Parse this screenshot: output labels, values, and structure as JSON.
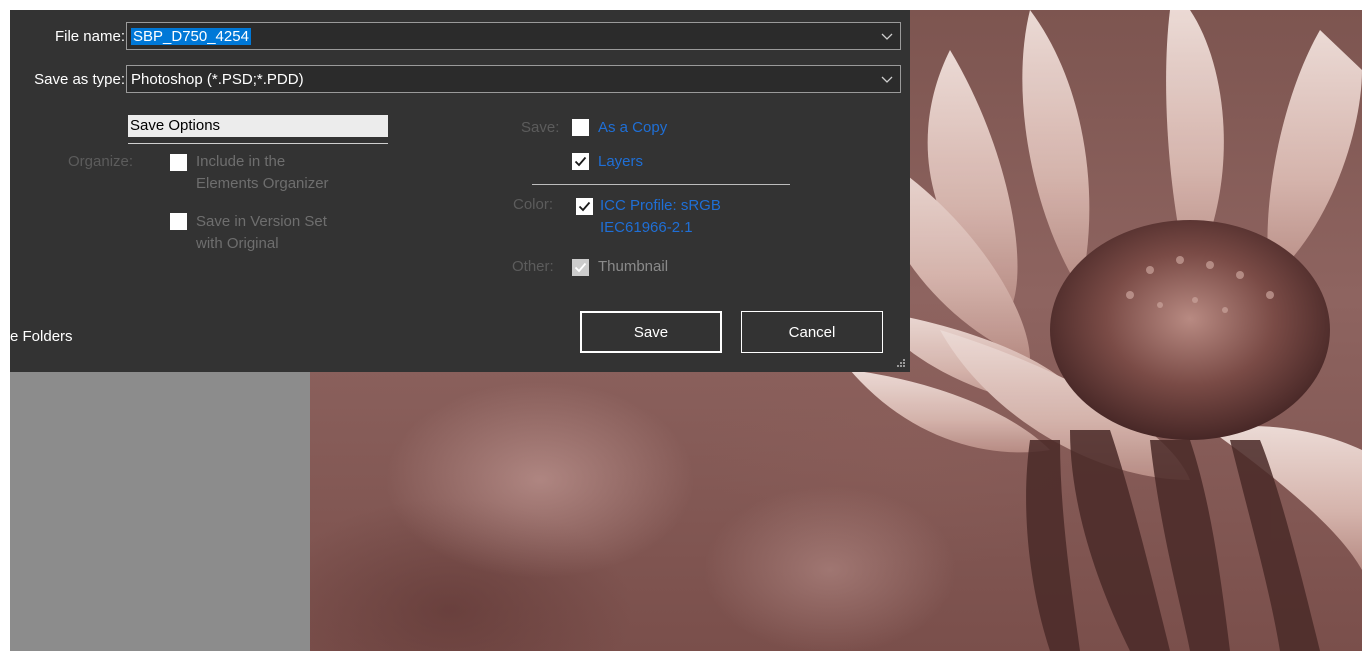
{
  "dialog": {
    "file_name_label": "File name:",
    "file_name_value": "SBP_D750_4254",
    "save_as_type_label": "Save as type:",
    "save_as_type_value": "Photoshop (*.PSD;*.PDD)",
    "section_title": "Save Options",
    "organize": {
      "label": "Organize:",
      "include_line1": "Include in the",
      "include_line2": "Elements Organizer",
      "include_checked": false,
      "version_line1": "Save in Version Set",
      "version_line2": "with Original",
      "version_checked": false
    },
    "save_group": {
      "label": "Save:",
      "as_copy": "As a Copy",
      "as_copy_checked": false,
      "layers": "Layers",
      "layers_checked": true
    },
    "color_group": {
      "label": "Color:",
      "icc_line1": "ICC Profile:  sRGB",
      "icc_line2": "IEC61966-2.1",
      "icc_checked": true
    },
    "other_group": {
      "label": "Other:",
      "thumbnail": "Thumbnail",
      "thumbnail_checked": true
    },
    "folders_label": "e Folders",
    "save_button": "Save",
    "cancel_button": "Cancel"
  },
  "colors": {
    "dialog_bg": "#333333",
    "selection_blue": "#0078d7",
    "link_blue": "#1f6fd6",
    "photo_tint": "#8e6460"
  },
  "icons": [
    "chevron-down-icon",
    "checkmark-icon",
    "resize-grip-icon"
  ]
}
